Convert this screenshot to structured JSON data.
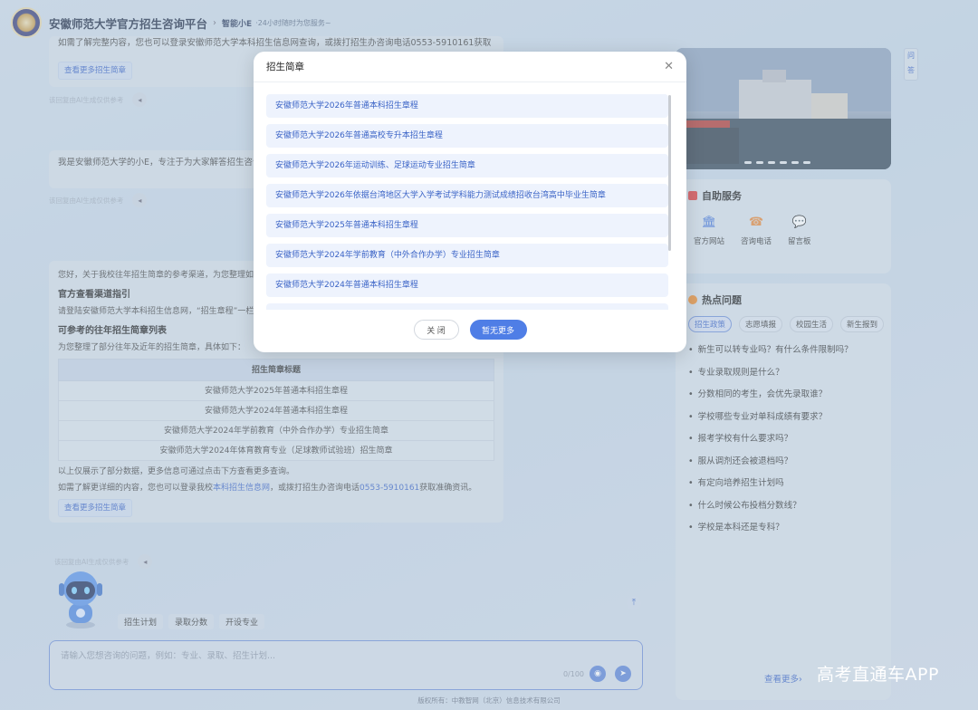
{
  "header": {
    "title": "安徽师范大学官方招生咨询平台",
    "brand": "智能小E",
    "slogan": "·24小时随时为您服务~"
  },
  "chat": {
    "top_fragment": "如需了解完整内容，您也可以登录安徽师范大学本科招生信息网查询，或拨打招生办咨询电话0553-5910161获取准确资讯。",
    "top_more": "查看更多招生简章",
    "meta_text": "该回复由AI生成仅供参考",
    "intro": "我是安徽师范大学的小E，专注于为大家解答招生咨询问题，请问您想了解哪些方面的信息吗？",
    "intro_meta": "该回复由AI生成仅供参考"
  },
  "answer": {
    "opening": "您好，关于我校往年招生简章的参考渠道，为您整理如下：",
    "h1": "官方查看渠道指引",
    "p1": "请登陆安徽师范大学本科招生信息网，“招生章程”一栏可查看往年招生简章。",
    "h2": "可参考的往年招生简章列表",
    "p2": "为您整理了部分往年及近年的招生简章，具体如下：",
    "table_header": "招生简章标题",
    "rows": [
      "安徽师范大学2025年普通本科招生章程",
      "安徽师范大学2024年普通本科招生章程",
      "安徽师范大学2024年学前教育（中外合作办学）专业招生简章",
      "安徽师范大学2024年体育教育专业（足球教师试验班）招生简章"
    ],
    "p3": "以上仅展示了部分数据，更多信息可通过点击下方查看更多查询。",
    "p4_prefix": "如需了解更详细的内容，您也可以登录我校",
    "p4_link": "本科招生信息网",
    "p4_mid": "，或拨打招生办咨询电话",
    "p4_phone": "0553-5910161",
    "p4_suffix": "获取准确资讯。",
    "more": "查看更多招生简章",
    "meta": "该回复由AI生成仅供参考"
  },
  "quick": [
    "招生计划",
    "录取分数",
    "开设专业"
  ],
  "input": {
    "placeholder": "请输入您想咨询的问题，例如：专业、录取、招生计划...",
    "counter": "0/100"
  },
  "footer": "版权所有：中教智网（北京）信息技术有限公司",
  "side": {
    "tab": "问答",
    "self_service_title": "自助服务",
    "services": [
      {
        "label": "官方网站",
        "icon": "building-icon",
        "color": "#3b6fd8"
      },
      {
        "label": "咨询电话",
        "icon": "phone-icon",
        "color": "#e8893a"
      },
      {
        "label": "留言板",
        "icon": "message-icon",
        "color": "#3aab5c"
      }
    ],
    "hot_title": "热点问题",
    "tags": [
      "招生政策",
      "志愿填报",
      "校园生活",
      "新生报到"
    ],
    "questions": [
      "新生可以转专业吗？有什么条件限制吗？",
      "专业录取规则是什么？",
      "分数相同的考生，会优先录取谁？",
      "学校哪些专业对单科成绩有要求？",
      "报考学校有什么要求吗？",
      "服从调剂还会被退档吗？",
      "有定向培养招生计划吗",
      "什么时候公布投档分数线？",
      "学校是本科还是专科？"
    ],
    "see_more": "查看更多›"
  },
  "watermark": "高考直通车APP",
  "modal": {
    "title": "招生简章",
    "items": [
      "安徽师范大学2026年普通本科招生章程",
      "安徽师范大学2026年普通高校专升本招生章程",
      "安徽师范大学2026年运动训练、足球运动专业招生简章",
      "安徽师范大学2026年依据台湾地区大学入学考试学科能力测试成绩招收台湾高中毕业生简章",
      "安徽师范大学2025年普通本科招生章程",
      "安徽师范大学2024年学前教育（中外合作办学）专业招生简章",
      "安徽师范大学2024年普通本科招生章程"
    ],
    "close_label": "关 闭",
    "more_label": "暂无更多"
  },
  "colors": {
    "accent": "#4f7ee6",
    "link": "#3a63c6"
  }
}
